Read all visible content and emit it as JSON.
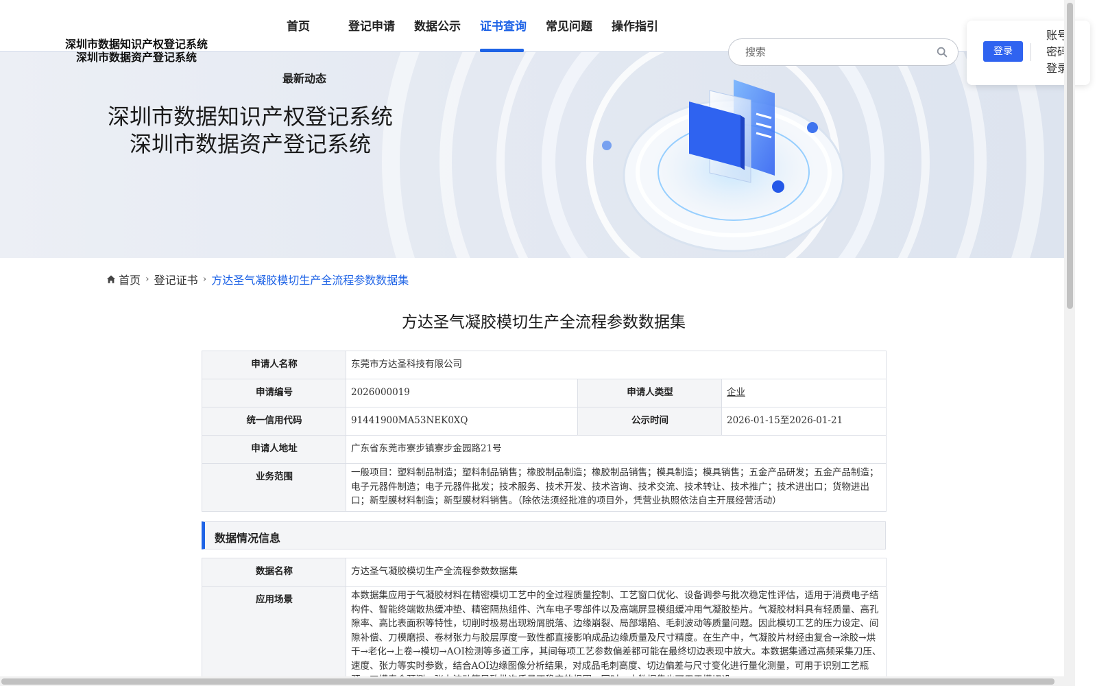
{
  "header": {
    "logo_line1": "深圳市数据知识产权登记系统",
    "logo_line2": "深圳市数据资产登记系统",
    "nav": [
      {
        "label": "首页",
        "active": false
      },
      {
        "label": "登记申请",
        "active": false
      },
      {
        "label": "数据公示",
        "active": false
      },
      {
        "label": "证书查询",
        "active": true
      },
      {
        "label": "常见问题",
        "active": false
      },
      {
        "label": "操作指引",
        "active": false
      }
    ],
    "nav_sub": "最新动态",
    "search_placeholder": "搜索",
    "login_button": "登录",
    "password_login": "账号密码登录",
    "accent_color": "#1e63e6"
  },
  "banner": {
    "title_line1": "深圳市数据知识产权登记系统",
    "title_line2": "深圳市数据资产登记系统"
  },
  "breadcrumb": {
    "home": "首页",
    "level2": "登记证书",
    "current": "方达圣气凝胶模切生产全流程参数数据集"
  },
  "doc_title": "方达圣气凝胶模切生产全流程参数数据集",
  "applicant": {
    "name_label": "申请人名称",
    "name_value": "东莞市方达圣科技有限公司",
    "number_label": "申请编号",
    "number_value": "2026000019",
    "type_label": "申请人类型",
    "type_value": "企业",
    "credit_label": "统一信用代码",
    "credit_value": "91441900MA53NEK0XQ",
    "publicity_label": "公示时间",
    "publicity_value": "2026-01-15至2026-01-21",
    "address_label": "申请人地址",
    "address_value": "广东省东莞市寮步镇寮步金园路21号",
    "scope_label": "业务范围",
    "scope_value": "一般项目：塑料制品制造；塑料制品销售；橡胶制品制造；橡胶制品销售；模具制造；模具销售；五金产品研发；五金产品制造；电子元器件制造；电子元器件批发；技术服务、技术开发、技术咨询、技术交流、技术转让、技术推广；技术进出口；货物进出口；新型膜材料制造；新型膜材料销售。（除依法须经批准的项目外，凭营业执照依法自主开展经营活动）"
  },
  "data_section": {
    "header": "数据情况信息",
    "name_label": "数据名称",
    "name_value": "方达圣气凝胶模切生产全流程参数数据集",
    "scene_label": "应用场景",
    "scene_value": "本数据集应用于气凝胶材料在精密模切工艺中的全过程质量控制、工艺窗口优化、设备调参与批次稳定性评估，适用于消费电子结构件、智能终端散热缓冲垫、精密隔热组件、汽车电子零部件以及高端屏显模组缓冲用气凝胶垫片。气凝胶材料具有轻质量、高孔隙率、高比表面积等特性，切削时极易出现粉屑脱落、边缘崩裂、局部塌陷、毛刺波动等质量问题。因此模切工艺的压力设定、间隙补偿、刀模磨损、卷材张力与胶层厚度一致性都直接影响成品边缘质量及尺寸精度。在生产中，气凝胶片材经由复合→涂胶→烘干→老化→上卷→模切→AOI检测等多道工序，其间每项工艺参数偏差都可能在最终切边表现中放大。本数据集通过高频采集刀压、速度、张力等实时参数，结合AOI边缘图像分析结果，对成品毛刺高度、切边偏差与尺寸变化进行量化测量，可用于识别工艺瓶颈、刀模寿命预测、张力波动等导致批次质量不稳定的根因。同时，本数据集也可用于模切设"
  }
}
